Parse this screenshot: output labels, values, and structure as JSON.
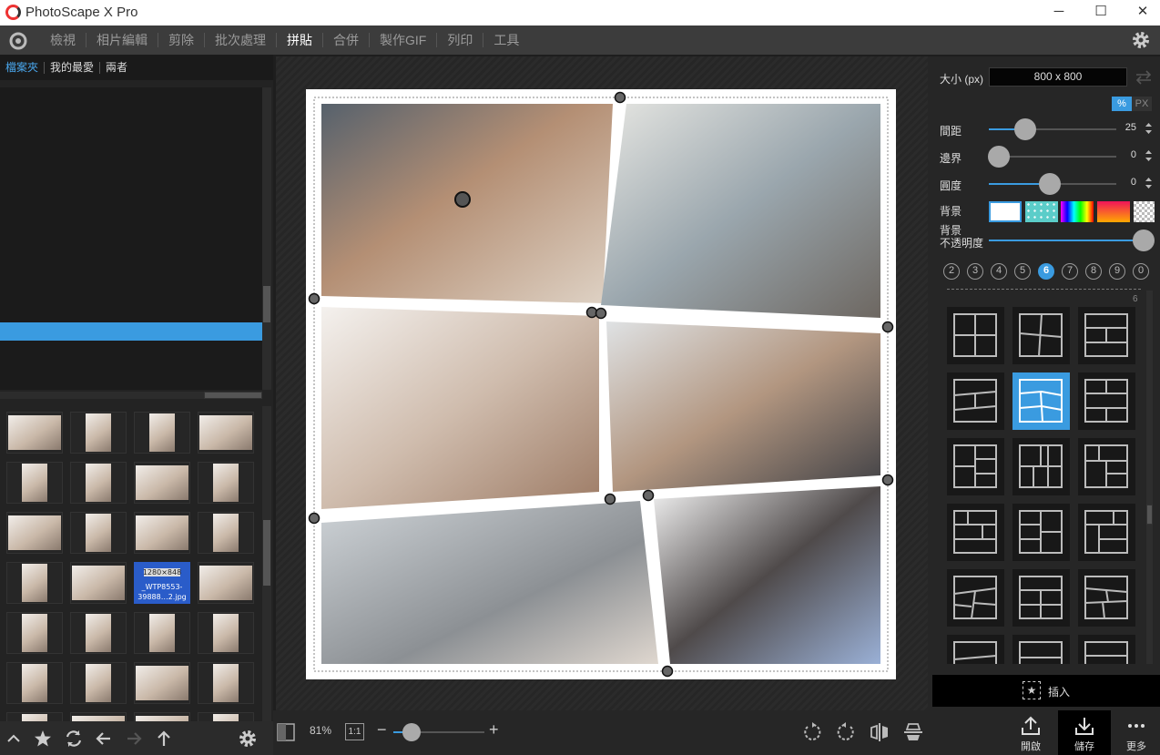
{
  "app": {
    "title": "PhotoScape X Pro"
  },
  "window_controls": {
    "minimize": "─",
    "maximize": "☐",
    "close": "✕"
  },
  "menu": {
    "items": [
      "檢視",
      "相片編輯",
      "剪除",
      "批次處理",
      "拼貼",
      "合併",
      "製作GIF",
      "列印",
      "工具"
    ],
    "active": "拼貼"
  },
  "left": {
    "tabs": [
      "檔案夾",
      "我的最愛",
      "兩者"
    ],
    "selected_thumb": {
      "line1": "1280×848",
      "line2": "_WTP8553-",
      "line3": "39888…2.jpg"
    }
  },
  "bottom": {
    "zoom": "81%",
    "one_to_one": "1:1",
    "minus": "−",
    "plus": "+",
    "open_label": "開啟",
    "save_label": "儲存",
    "more_label": "更多",
    "zoom_level_fraction": 0.2
  },
  "right": {
    "size_label": "大小 (px)",
    "size_value": "800 x 800",
    "unit_percent": "%",
    "unit_px": "PX",
    "spacing_label": "間距",
    "spacing_value": "25",
    "border_label": "邊界",
    "border_value": "0",
    "roundness_label": "圓度",
    "roundness_value": "0",
    "background_label": "背景",
    "opacity_label_line1": "背景",
    "opacity_label_line2": "不透明度",
    "opacity_value_fraction": 1.0,
    "counts": [
      "2",
      "3",
      "4",
      "5",
      "6",
      "7",
      "8",
      "9",
      "0"
    ],
    "active_count": "6",
    "template_count": "6",
    "insert_label": "插入",
    "insert_icon": "★",
    "accent": "#3a9be0"
  }
}
